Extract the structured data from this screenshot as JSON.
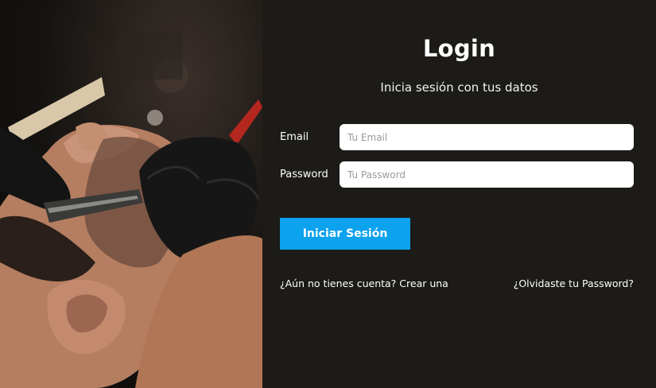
{
  "hero": {
    "image_subject": "barber shaving a man's beard with a straight razor"
  },
  "login": {
    "title": "Login",
    "subtitle": "Inicia sesión con tus datos",
    "email_label": "Email",
    "email_placeholder": "Tu Email",
    "email_value": "",
    "password_label": "Password",
    "password_placeholder": "Tu Password",
    "password_value": "",
    "submit_label": "Iniciar Sesión",
    "create_account_link": "¿Aún no tienes cuenta? Crear una",
    "forgot_password_link": "¿Olvidaste tu Password?"
  },
  "colors": {
    "panel_background": "#1c1b17",
    "button": "#0da2ee",
    "text": "#ffffff"
  }
}
